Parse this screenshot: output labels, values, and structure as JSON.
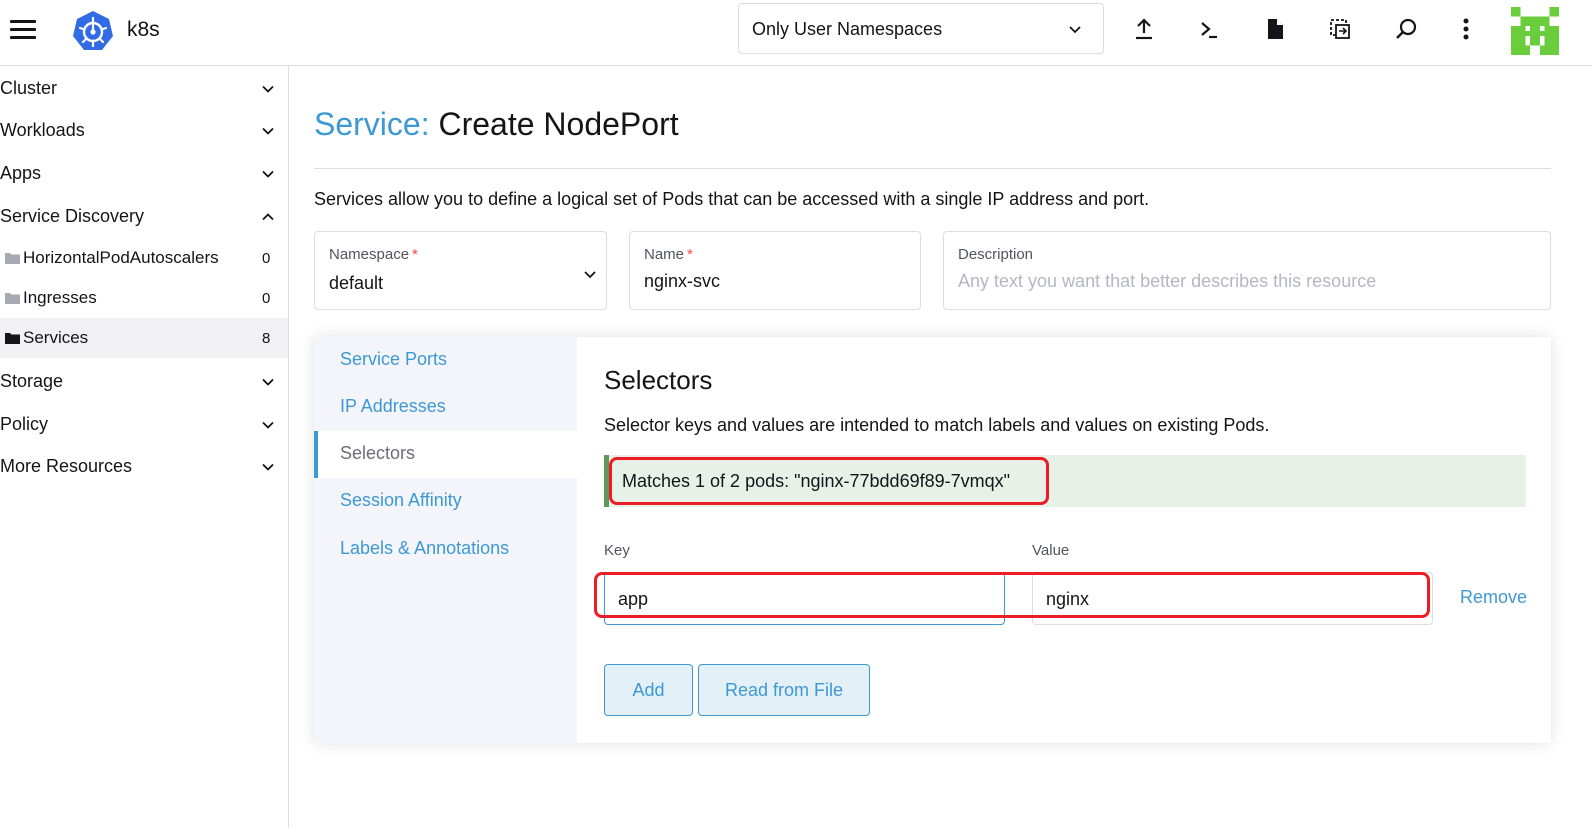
{
  "header": {
    "cluster_name": "k8s",
    "namespace_filter": "Only User Namespaces",
    "icons": [
      "upload-icon",
      "terminal-icon",
      "file-icon",
      "copy-config-icon",
      "search-icon",
      "more-vertical-icon"
    ]
  },
  "sidebar": {
    "groups_top": [
      {
        "label": "Cluster",
        "expanded": false
      },
      {
        "label": "Workloads",
        "expanded": false
      },
      {
        "label": "Apps",
        "expanded": false
      },
      {
        "label": "Service Discovery",
        "expanded": true
      }
    ],
    "items": [
      {
        "label": "HorizontalPodAutoscalers",
        "count": "0",
        "active": false
      },
      {
        "label": "Ingresses",
        "count": "0",
        "active": false
      },
      {
        "label": "Services",
        "count": "8",
        "active": true
      }
    ],
    "groups_bottom": [
      {
        "label": "Storage",
        "expanded": false
      },
      {
        "label": "Policy",
        "expanded": false
      },
      {
        "label": "More Resources",
        "expanded": false
      }
    ]
  },
  "page": {
    "resource_type": "Service:",
    "title": "Create NodePort",
    "description": "Services allow you to define a logical set of Pods that can be accessed with a single IP address and port."
  },
  "form": {
    "namespace": {
      "label": "Namespace",
      "required_mark": "*",
      "value": "default"
    },
    "name": {
      "label": "Name",
      "required_mark": "*",
      "value": "nginx-svc"
    },
    "description": {
      "label": "Description",
      "placeholder": "Any text you want that better describes this resource"
    }
  },
  "tabs": [
    {
      "label": "Service Ports",
      "active": false
    },
    {
      "label": "IP Addresses",
      "active": false
    },
    {
      "label": "Selectors",
      "active": true
    },
    {
      "label": "Session Affinity",
      "active": false
    },
    {
      "label": "Labels & Annotations",
      "active": false
    }
  ],
  "selectors": {
    "title": "Selectors",
    "description": "Selector keys and values are intended to match labels and values on existing Pods.",
    "match_banner": "Matches 1 of 2 pods: \"nginx-77bdd69f89-7vmqx\"",
    "key_label": "Key",
    "value_label": "Value",
    "rows": [
      {
        "key": "app",
        "value": "nginx"
      }
    ],
    "remove_label": "Remove",
    "add_label": "Add",
    "read_from_file_label": "Read from File"
  },
  "colors": {
    "accent": "#3d98d3",
    "success_banner_bg": "#e7f1e8",
    "success_banner_border": "#5d995d",
    "annotation_red": "#ee1c25"
  }
}
